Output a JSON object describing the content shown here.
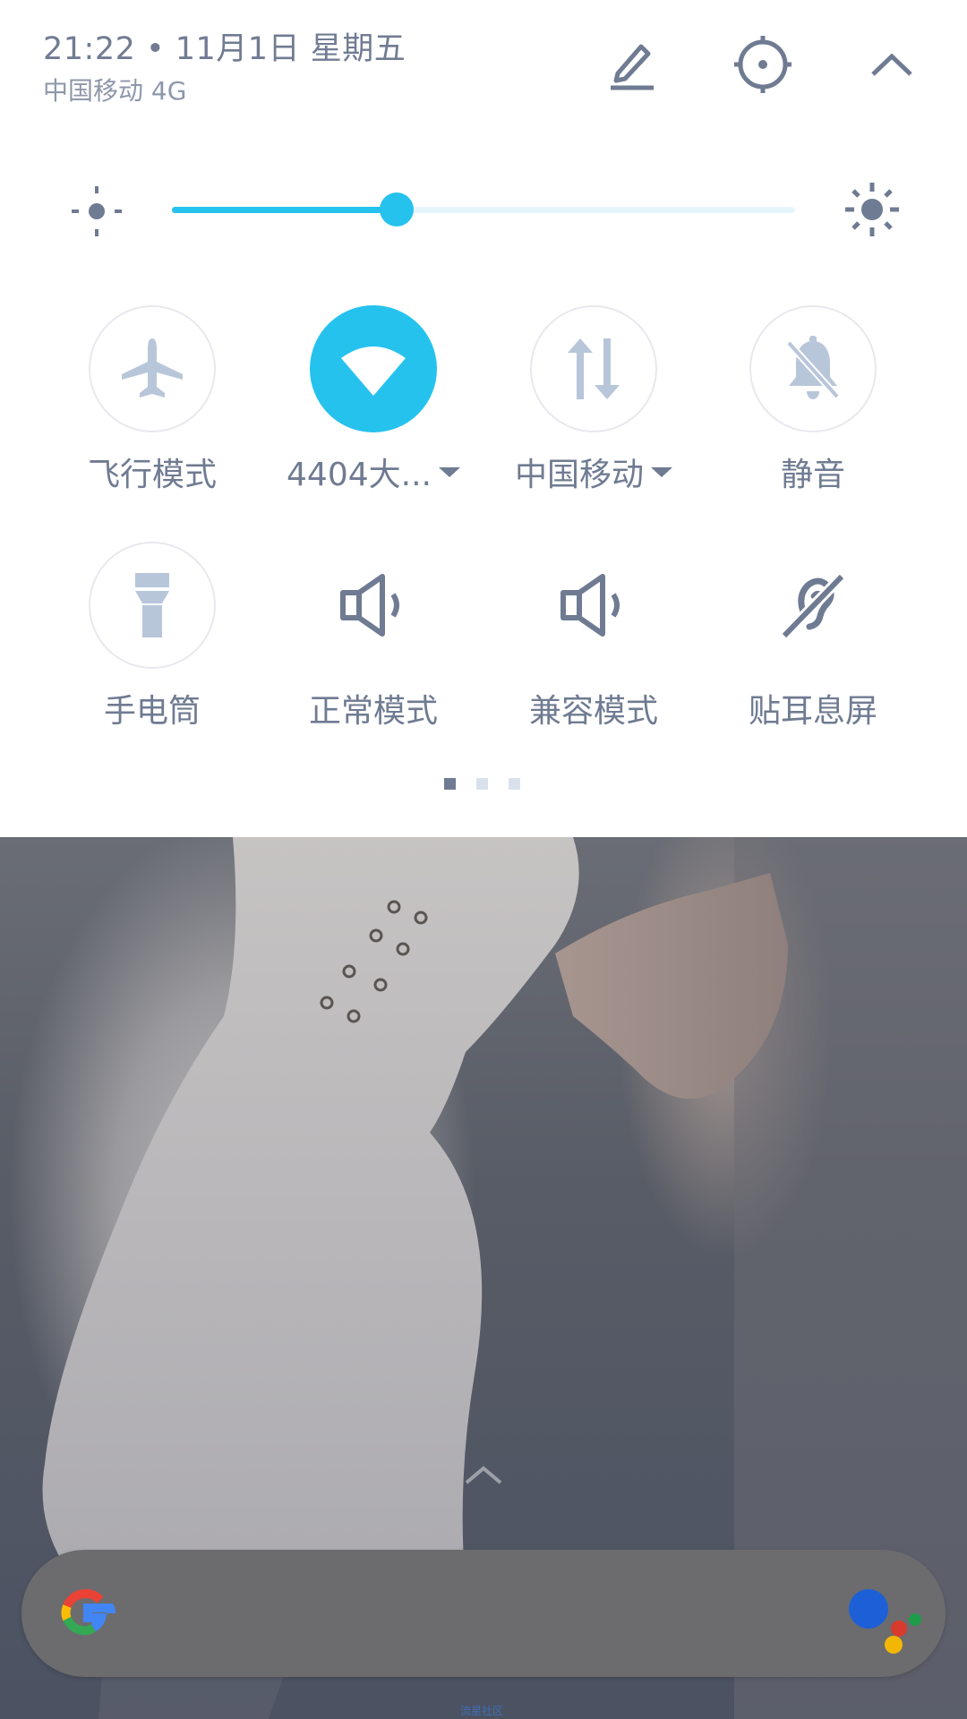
{
  "header": {
    "datetime": "21:22 • 11月1日  星期五",
    "carrier": "中国移动 4G",
    "buttons": [
      "edit-icon",
      "settings-icon",
      "collapse-icon"
    ]
  },
  "brightness": {
    "level_fraction": 0.36,
    "low_icon": "brightness-low-icon",
    "high_icon": "brightness-high-icon"
  },
  "tiles": [
    {
      "label": "飞行模式",
      "icon": "airplane-icon",
      "active": false,
      "has_dropdown": false
    },
    {
      "label": "4404大...",
      "icon": "wifi-icon",
      "active": true,
      "has_dropdown": true
    },
    {
      "label": "中国移动",
      "icon": "mobile-data-icon",
      "active": false,
      "has_dropdown": true
    },
    {
      "label": "静音",
      "icon": "mute-bell-icon",
      "active": false,
      "has_dropdown": false
    },
    {
      "label": "手电筒",
      "icon": "flashlight-icon",
      "active": false,
      "has_dropdown": false
    },
    {
      "label": "正常模式",
      "icon": "speaker-icon",
      "active": false,
      "has_dropdown": false
    },
    {
      "label": "兼容模式",
      "icon": "speaker-icon",
      "active": false,
      "has_dropdown": false
    },
    {
      "label": "贴耳息屏",
      "icon": "hearing-icon",
      "active": false,
      "has_dropdown": false
    }
  ],
  "pager": {
    "count": 3,
    "current": 1
  },
  "home": {
    "search_icon": "google-icon",
    "assistant_icon": "google-assistant-icon",
    "watermark": "流星社区"
  },
  "colors": {
    "accent": "#26c2ee",
    "icon": "#6f7b92",
    "icon_light": "#b8c6da"
  }
}
